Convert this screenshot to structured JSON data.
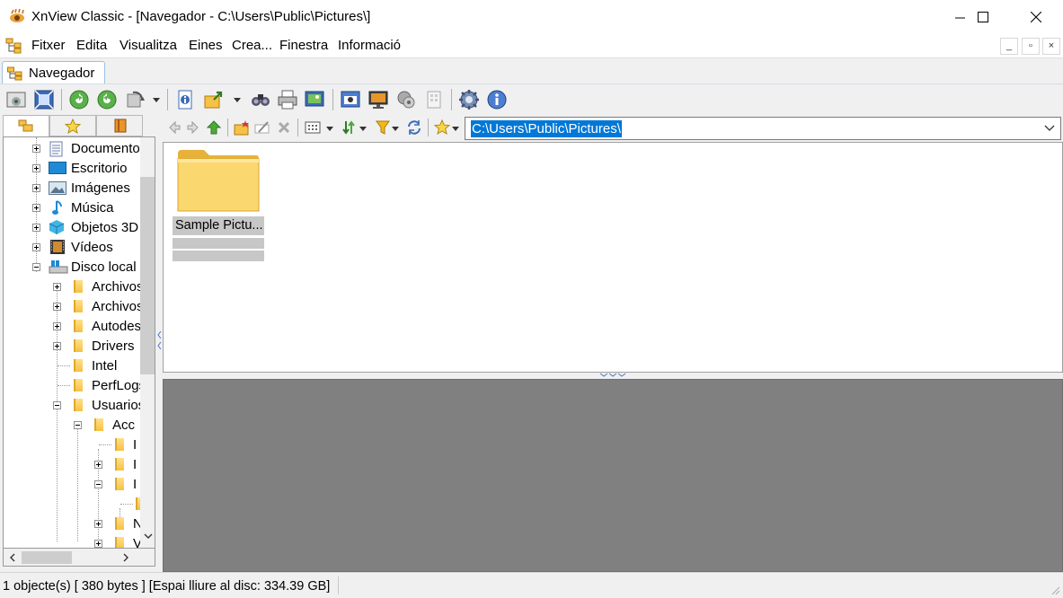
{
  "window": {
    "title": "XnView Classic - [Navegador - C:\\Users\\Public\\Pictures\\]",
    "app_icon": "xnview-eye-icon",
    "controls": [
      "minimize-icon",
      "maximize-icon",
      "close-icon"
    ]
  },
  "menubar": {
    "items": [
      "Fitxer",
      "Edita",
      "Visualitza",
      "Eines",
      "Crea...",
      "Finestra",
      "Informació"
    ],
    "mdi_controls": [
      "_",
      "▫",
      "×"
    ]
  },
  "tabs": [
    {
      "label": "Navegador",
      "active": true
    }
  ],
  "toolbar": {
    "buttons": [
      "fullscreen-view-icon",
      "fit-screen-icon",
      "refresh-icon",
      "refresh-alt-icon",
      "rotate-icon",
      "file-info-icon",
      "export-icon",
      "find-icon",
      "print-icon",
      "slideshow-icon",
      "screenshot-icon",
      "wallpaper-icon",
      "batch-icon",
      "grid-icon",
      "settings-icon",
      "about-icon"
    ]
  },
  "left_panel": {
    "tabs": [
      "folders-icon",
      "favorites-icon",
      "catalog-icon"
    ],
    "tree": [
      {
        "label": "Documentos",
        "icon": "documents-icon",
        "expanded": false
      },
      {
        "label": "Escritorio",
        "icon": "desktop-icon",
        "expanded": false
      },
      {
        "label": "Imágenes",
        "icon": "pictures-icon",
        "expanded": false
      },
      {
        "label": "Música",
        "icon": "music-icon",
        "expanded": false
      },
      {
        "label": "Objetos 3D",
        "icon": "3d-objects-icon",
        "expanded": false
      },
      {
        "label": "Vídeos",
        "icon": "videos-icon",
        "expanded": false
      },
      {
        "label": "Disco local",
        "icon": "local-disk-icon",
        "expanded": true
      },
      {
        "label": "Archivos",
        "icon": "folder-icon",
        "expanded": false
      },
      {
        "label": "Archivos",
        "icon": "folder-icon",
        "expanded": false
      },
      {
        "label": "Autodesk",
        "icon": "folder-icon",
        "expanded": false
      },
      {
        "label": "Drivers",
        "icon": "folder-icon",
        "expanded": false
      },
      {
        "label": "Intel",
        "icon": "folder-icon",
        "expanded": null
      },
      {
        "label": "PerfLogs",
        "icon": "folder-icon",
        "expanded": null
      },
      {
        "label": "Usuarios",
        "icon": "folder-icon",
        "expanded": true
      },
      {
        "label": "Acc",
        "icon": "folder-icon",
        "expanded": true
      },
      {
        "label": "I",
        "icon": "folder-icon",
        "expanded": null
      },
      {
        "label": "I",
        "icon": "folder-icon",
        "expanded": false
      },
      {
        "label": "I",
        "icon": "folder-icon",
        "expanded": true
      },
      {
        "label": "",
        "icon": "folder-icon",
        "expanded": null
      },
      {
        "label": "N",
        "icon": "folder-icon",
        "expanded": false
      },
      {
        "label": "V",
        "icon": "folder-icon",
        "expanded": false
      }
    ]
  },
  "browser": {
    "path": "C:\\Users\\Public\\Pictures\\",
    "items": [
      {
        "name": "Sample Pictu...",
        "type": "folder"
      }
    ]
  },
  "statusbar": {
    "text": "1 objecte(s) [ 380 bytes ] [Espai lliure al disc: 334.39 GB]"
  }
}
